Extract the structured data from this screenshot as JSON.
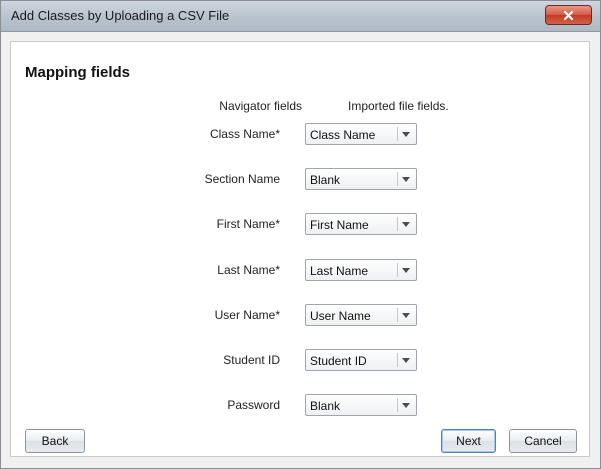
{
  "window": {
    "title": "Add Classes by Uploading a CSV File",
    "close_icon": "close-x-icon",
    "close_color": "#c9432b"
  },
  "main": {
    "heading": "Mapping fields",
    "column_headers": {
      "navigator": "Navigator fields",
      "imported": "Imported file fields."
    },
    "rows": [
      {
        "label": "Class Name*",
        "value": "Class Name"
      },
      {
        "label": "Section Name",
        "value": "Blank"
      },
      {
        "label": "First Name*",
        "value": "First Name"
      },
      {
        "label": "Last Name*",
        "value": "Last Name"
      },
      {
        "label": "User Name*",
        "value": "User Name"
      },
      {
        "label": "Student ID",
        "value": "Student ID"
      },
      {
        "label": "Password",
        "value": "Blank"
      }
    ]
  },
  "footer": {
    "back_label": "Back",
    "next_label": "Next",
    "cancel_label": "Cancel"
  }
}
